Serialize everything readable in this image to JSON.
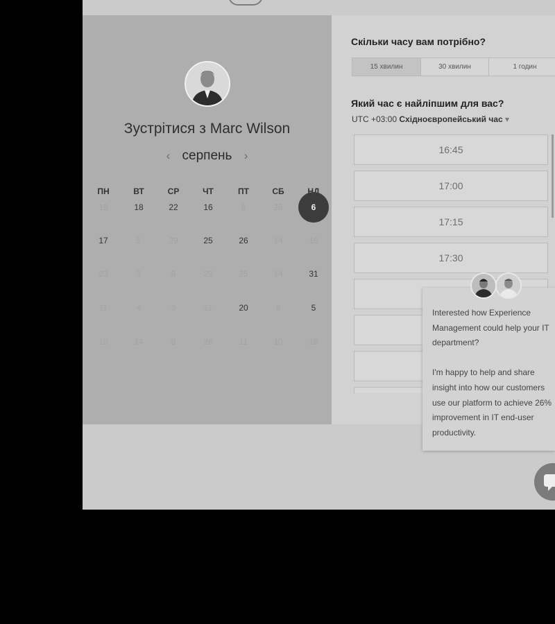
{
  "calendar": {
    "host_title": "Зустрітися з Marc Wilson",
    "month": "серпень",
    "prev_icon": "‹",
    "next_icon": "›",
    "weekdays": [
      "ПН",
      "ВТ",
      "СР",
      "ЧТ",
      "ПТ",
      "СБ",
      "НД"
    ],
    "weeks": [
      [
        "19",
        "18",
        "22",
        "16",
        "8",
        "26",
        "6"
      ],
      [
        "17",
        "5",
        "29",
        "25",
        "26",
        "14",
        "19"
      ],
      [
        "23",
        "3",
        "9",
        "29",
        "25",
        "14",
        "31"
      ],
      [
        "11",
        "4",
        "3",
        "11",
        "20",
        "6",
        "5"
      ],
      [
        "10",
        "14",
        "8",
        "26",
        "11",
        "10",
        "16"
      ]
    ],
    "selected_day": "6"
  },
  "booking": {
    "duration_question": "Скільки часу вам потрібно?",
    "durations": [
      "15 хвилин",
      "30 хвилин",
      "1 годин"
    ],
    "selected_duration": "15 хвилин",
    "time_question": "Який час є найліпшим для вас?",
    "timezone_prefix": "UTC +03:00",
    "timezone_name": "Східноєвропейський час",
    "timezone_caret": "▾",
    "slots": [
      "16:45",
      "17:00",
      "17:15",
      "17:30",
      "",
      "",
      ""
    ]
  },
  "chat": {
    "message": "Interested how Experience Management could help your IT department?\n\nI'm happy to help and share insight into how our customers use our platform to achieve 26% improvement in IT end-user productivity."
  }
}
